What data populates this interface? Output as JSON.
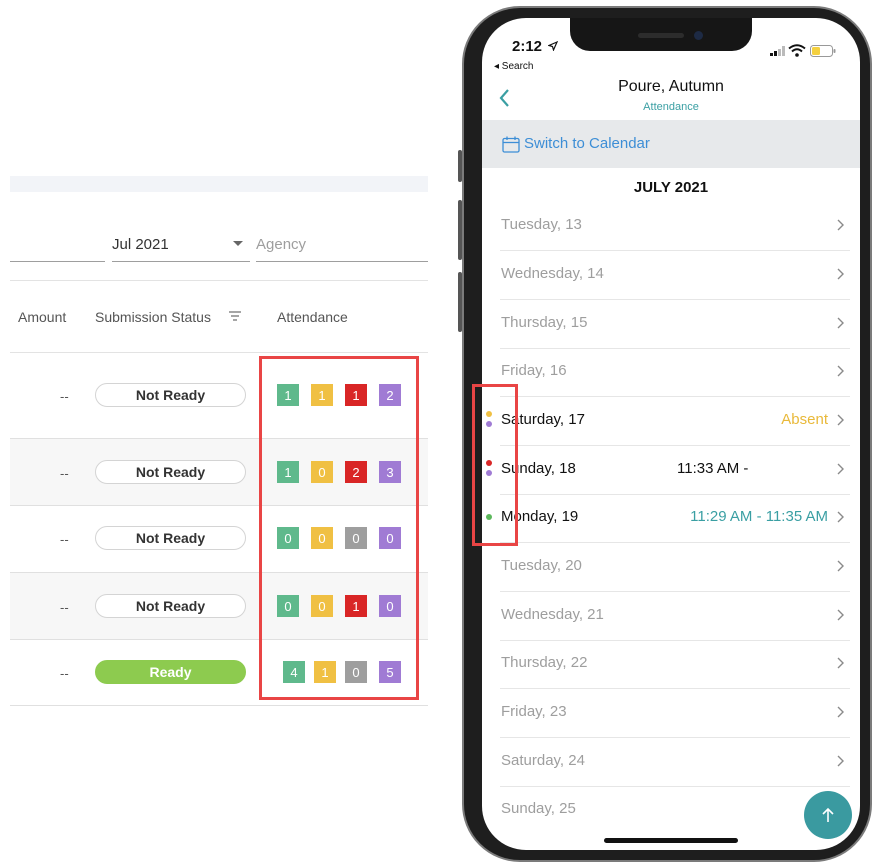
{
  "web": {
    "filters": {
      "month_value": "Jul 2021",
      "agency_placeholder": "Agency"
    },
    "columns": {
      "amount": "Amount",
      "submission_status": "Submission Status",
      "attendance": "Attendance"
    },
    "rows": [
      {
        "amount": "--",
        "status": "Not Ready",
        "attendance": [
          "1",
          "1",
          "1",
          "2"
        ]
      },
      {
        "amount": "--",
        "status": "Not Ready",
        "attendance": [
          "1",
          "0",
          "2",
          "3"
        ]
      },
      {
        "amount": "--",
        "status": "Not Ready",
        "attendance": [
          "0",
          "0",
          "0",
          "0"
        ]
      },
      {
        "amount": "--",
        "status": "Not Ready",
        "attendance": [
          "0",
          "0",
          "1",
          "0"
        ]
      },
      {
        "amount": "--",
        "status": "Ready",
        "attendance": [
          "4",
          "1",
          "0",
          "5"
        ]
      }
    ],
    "colors": {
      "present": "#5fb98c",
      "absent": "#f0c043",
      "red_badge": "#d92626",
      "gray_badge": "#9e9e9e",
      "purple_badge": "#a07bd4",
      "ready": "#8dcb4f",
      "highlight": "#e94545"
    }
  },
  "phone": {
    "status_bar": {
      "time": "2:12",
      "back_label": "◂ Search"
    },
    "nav": {
      "title": "Poure, Autumn",
      "subtitle": "Attendance"
    },
    "switch_label": "Switch to Calendar",
    "month": "JULY 2021",
    "days": [
      {
        "label": "Tuesday, 13",
        "status": "",
        "dots": []
      },
      {
        "label": "Wednesday, 14",
        "status": "",
        "dots": []
      },
      {
        "label": "Thursday, 15",
        "status": "",
        "dots": []
      },
      {
        "label": "Friday, 16",
        "status": "",
        "dots": []
      },
      {
        "label": "Saturday, 17",
        "status": "Absent",
        "dots": [
          "#f0c043",
          "#a07bd4"
        ]
      },
      {
        "label": "Sunday, 18",
        "status": "11:33 AM -",
        "dots": [
          "#d92626",
          "#a07bd4"
        ]
      },
      {
        "label": "Monday, 19",
        "status": "11:29 AM - 11:35 AM",
        "dots": [
          "#5cb85c"
        ]
      },
      {
        "label": "Tuesday, 20",
        "status": "",
        "dots": []
      },
      {
        "label": "Wednesday, 21",
        "status": "",
        "dots": []
      },
      {
        "label": "Thursday, 22",
        "status": "",
        "dots": []
      },
      {
        "label": "Friday, 23",
        "status": "",
        "dots": []
      },
      {
        "label": "Saturday, 24",
        "status": "",
        "dots": []
      },
      {
        "label": "Sunday, 25",
        "status": "",
        "dots": []
      }
    ],
    "icons": {
      "back": "chevron-left-icon",
      "calendar": "calendar-icon",
      "row_chevron": "chevron-right-icon",
      "fab": "arrow-up-icon"
    },
    "colors": {
      "accent": "#3a9fa3",
      "link": "#3d8ed6",
      "absent_text": "#e9b93a"
    }
  }
}
